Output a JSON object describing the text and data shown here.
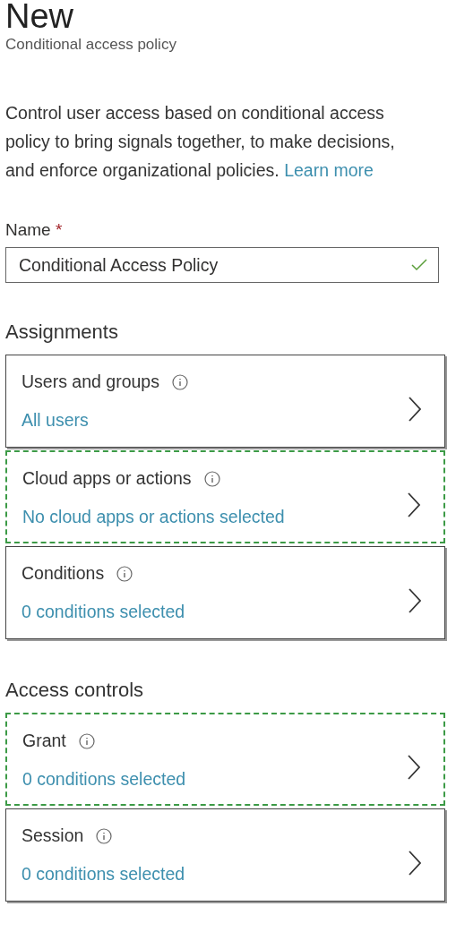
{
  "header": {
    "title": "New",
    "subtitle": "Conditional access policy"
  },
  "description": {
    "text": "Control user access based on conditional access policy to bring signals together, to make decisions, and enforce organizational policies.",
    "link": "Learn more"
  },
  "name_field": {
    "label": "Name",
    "required_mark": "*",
    "value": "Conditional Access Policy",
    "valid": true
  },
  "sections": [
    {
      "heading": "Assignments",
      "items": [
        {
          "title": "Users and groups",
          "value": "All users",
          "highlighted": false
        },
        {
          "title": "Cloud apps or actions",
          "value": "No cloud apps or actions selected",
          "highlighted": true
        },
        {
          "title": "Conditions",
          "value": "0 conditions selected",
          "highlighted": false
        }
      ]
    },
    {
      "heading": "Access controls",
      "items": [
        {
          "title": "Grant",
          "value": "0 conditions selected",
          "highlighted": true
        },
        {
          "title": "Session",
          "value": "0 conditions selected",
          "highlighted": false
        }
      ]
    }
  ]
}
